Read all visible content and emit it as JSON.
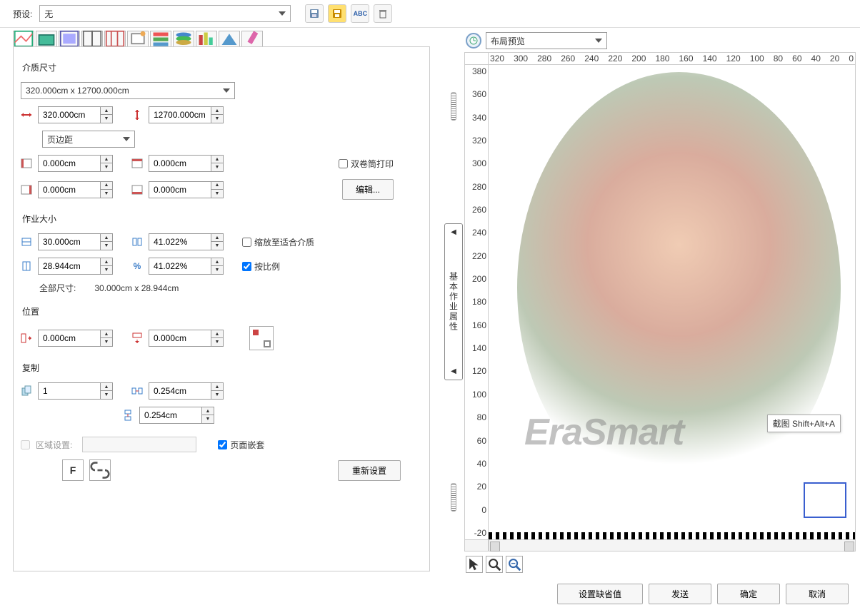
{
  "preset": {
    "label": "预设:",
    "value": "无"
  },
  "toolbar_top": [
    "save-icon",
    "open-icon",
    "abc-icon",
    "delete-icon"
  ],
  "vertical_handle_label": "基本作业属性",
  "media_size": {
    "title": "介质尺寸",
    "preset_select": "320.000cm x 12700.000cm",
    "width": "320.000cm",
    "height": "12700.000cm",
    "margin_select": "页边距",
    "m_left": "0.000cm",
    "m_top": "0.000cm",
    "m_right": "0.000cm",
    "m_bottom": "0.000cm",
    "duplex_label": "双卷筒打印",
    "edit_btn": "编辑..."
  },
  "job_size": {
    "title": "作业大小",
    "w": "30.000cm",
    "h": "28.944cm",
    "pw": "41.022%",
    "ph": "41.022%",
    "fit_label": "缩放至适合介质",
    "lock_label": "按比例",
    "all_label": "全部尺寸:",
    "all_value": "30.000cm x 28.944cm",
    "percent_symbol": "%"
  },
  "position": {
    "title": "位置",
    "x": "0.000cm",
    "y": "0.000cm"
  },
  "copy": {
    "title": "复制",
    "count": "1",
    "gap_h": "0.254cm",
    "gap_v": "0.254cm"
  },
  "region": {
    "label": "区域设置:",
    "nest_label": "页面嵌套"
  },
  "reset_btn": "重新设置",
  "f_btn": "F",
  "preview": {
    "select": "布局预览",
    "tooltip": "截图 Shift+Alt+A",
    "watermark": "EraSmart",
    "ruler_top": [
      "320",
      "300",
      "280",
      "260",
      "240",
      "220",
      "200",
      "180",
      "160",
      "140",
      "120",
      "100",
      "80",
      "60",
      "40",
      "20",
      "0"
    ],
    "ruler_left": [
      "380",
      "360",
      "340",
      "320",
      "300",
      "280",
      "260",
      "240",
      "220",
      "200",
      "180",
      "160",
      "140",
      "120",
      "100",
      "80",
      "60",
      "40",
      "20",
      "0",
      "-20"
    ]
  },
  "footer": {
    "defaults": "设置缺省值",
    "send": "发送",
    "ok": "确定",
    "cancel": "取消"
  }
}
